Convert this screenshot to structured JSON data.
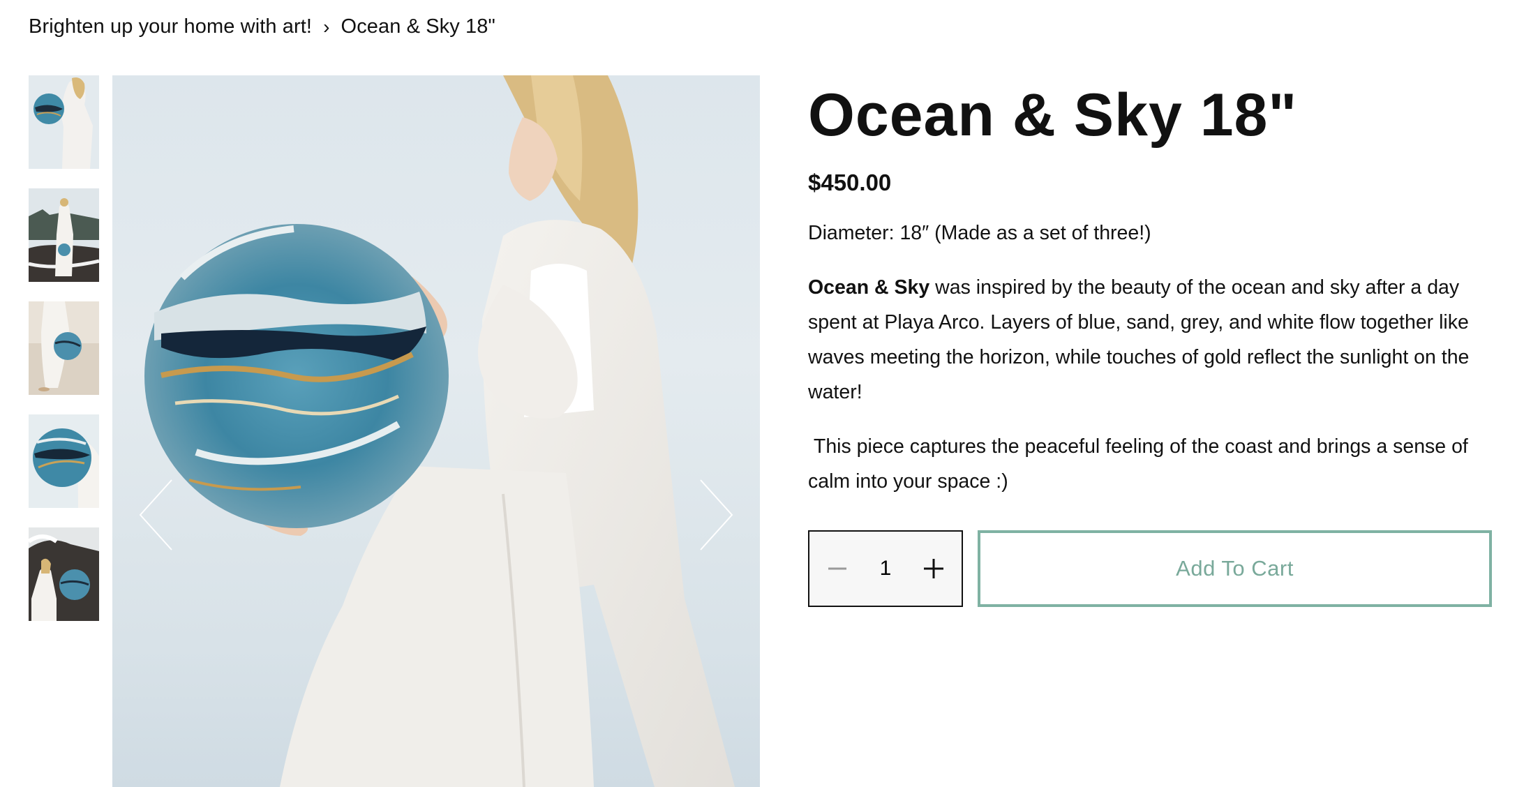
{
  "breadcrumb": {
    "parent": "Brighten up your home with art!",
    "separator": "›",
    "current": "Ocean & Sky 18\""
  },
  "product": {
    "title": "Ocean & Sky 18\"",
    "price": "$450.00",
    "diameter": "Diameter: 18″ (Made as a set of three!)",
    "description_bold": "Ocean & Sky",
    "description_rest": " was inspired by the beauty of the ocean and sky after a day spent at Playa Arco. Layers of blue, sand, grey, and white flow together like waves meeting the horizon, while touches of gold reflect the sunlight on the water!",
    "description_2": " This piece captures the peaceful feeling of the coast and brings a sense of calm into your space :)"
  },
  "quantity": {
    "value": "1"
  },
  "buttons": {
    "add_to_cart": "Add To Cart"
  },
  "gallery": {
    "thumbnail_count": 5,
    "selected_index": 0
  },
  "colors": {
    "accent": "#7fb2a3",
    "accent_text": "#79a99a",
    "text": "#111111"
  },
  "icons": {
    "prev": "chevron-left-icon",
    "next": "chevron-right-icon",
    "minus": "minus-icon",
    "plus": "plus-icon"
  }
}
